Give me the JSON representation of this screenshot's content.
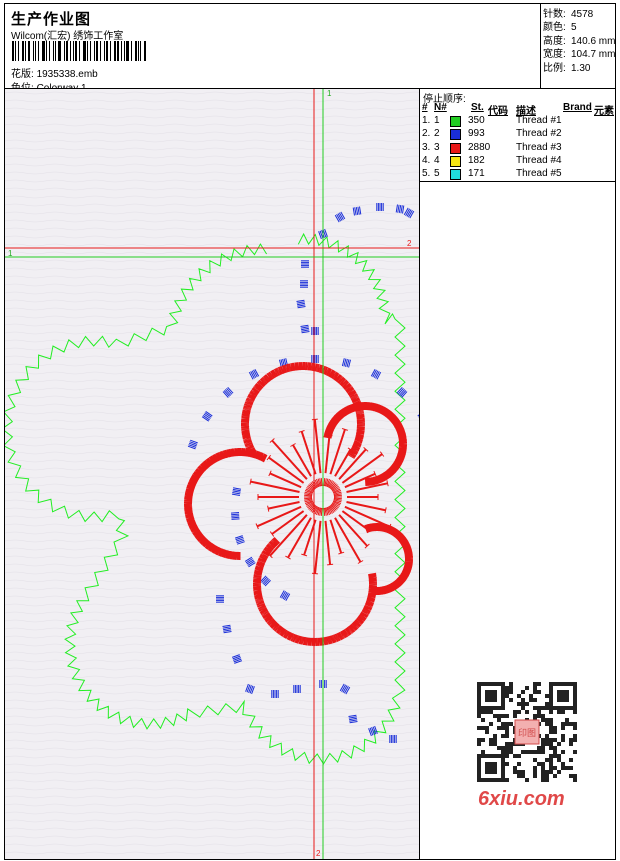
{
  "header": {
    "title": "生产作业图",
    "company": "Wilcom(汇宏) 绣饰工作室",
    "file_label": "花版:",
    "file_name": "1935338.emb",
    "colorway_label": "色位:",
    "colorway_name": "Colorway 1"
  },
  "info": {
    "stitches_label": "针数:",
    "stitches": "4578",
    "colors_label": "颜色:",
    "colors": "5",
    "height_label": "高度:",
    "height": "140.6 mm",
    "width_label": "宽度:",
    "width": "104.7 mm",
    "scale_label": "比例:",
    "scale": "1.30"
  },
  "color_panel": {
    "title": "停止顺序:",
    "headers": [
      "#",
      "N#",
      "St.",
      "代码",
      "描述",
      "Brand",
      "元素"
    ],
    "rows": [
      {
        "num": "1.",
        "n": "1",
        "st": "350",
        "desc": "Thread #1",
        "color": "#22cc22"
      },
      {
        "num": "2.",
        "n": "2",
        "st": "993",
        "desc": "Thread #2",
        "color": "#1a2ed8"
      },
      {
        "num": "3.",
        "n": "3",
        "st": "2880",
        "desc": "Thread #3",
        "color": "#e81818"
      },
      {
        "num": "4.",
        "n": "4",
        "st": "182",
        "desc": "Thread #4",
        "color": "#f5e414"
      },
      {
        "num": "5.",
        "n": "5",
        "st": "171",
        "desc": "Thread #5",
        "color": "#20dede"
      }
    ]
  },
  "guides": {
    "marker_1": "1",
    "marker_2": "2"
  },
  "watermark": {
    "site": "6xiu.com",
    "stamp": "印图"
  },
  "colors": {
    "green": "#22ee22",
    "blue": "#1a2ed8",
    "red": "#e81818",
    "guide_red": "#e81818",
    "guide_green": "#22cc22"
  }
}
